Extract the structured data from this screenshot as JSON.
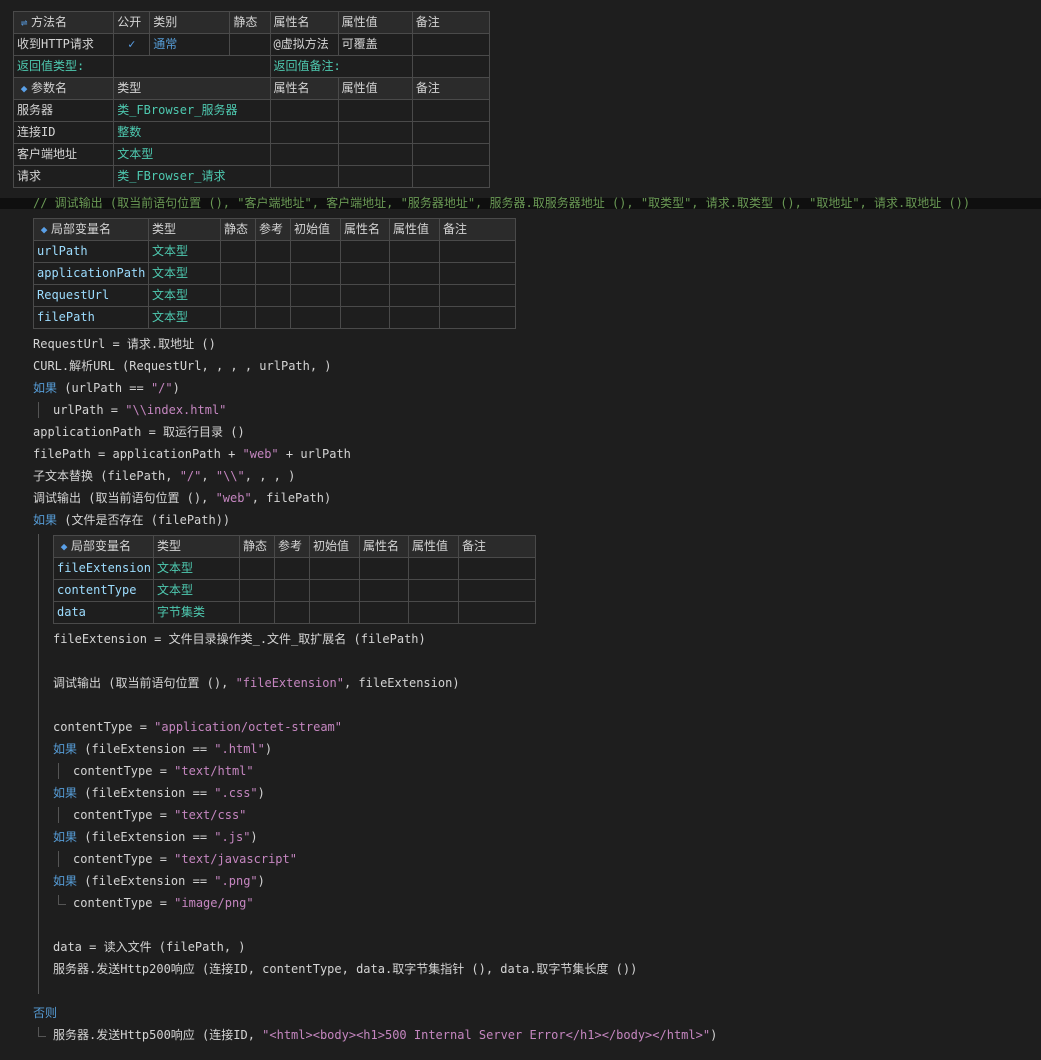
{
  "method_table": {
    "headers": [
      "方法名",
      "公开",
      "类别",
      "静态",
      "属性名",
      "属性值",
      "备注"
    ],
    "row": {
      "name": "收到HTTP请求",
      "public_check": "✓",
      "category": "通常",
      "attr_name": "@虚拟方法",
      "attr_value": "可覆盖"
    },
    "return_type_label": "返回值类型:",
    "return_note_label": "返回值备注:"
  },
  "param_table": {
    "headers": [
      "参数名",
      "类型",
      "属性名",
      "属性值",
      "备注"
    ],
    "rows": [
      {
        "name": "服务器",
        "type": "类_FBrowser_服务器"
      },
      {
        "name": "连接ID",
        "type": "整数"
      },
      {
        "name": "客户端地址",
        "type": "文本型"
      },
      {
        "name": "请求",
        "type": "类_FBrowser_请求"
      }
    ]
  },
  "comment_line": "// 调试输出 (取当前语句位置 (), \"客户端地址\", 客户端地址, \"服务器地址\", 服务器.取服务器地址 (), \"取类型\", 请求.取类型 (), \"取地址\", 请求.取地址 ())",
  "local_table_1": {
    "headers": [
      "局部变量名",
      "类型",
      "静态",
      "参考",
      "初始值",
      "属性名",
      "属性值",
      "备注"
    ],
    "rows": [
      {
        "name": "urlPath",
        "type": "文本型"
      },
      {
        "name": "applicationPath",
        "type": "文本型"
      },
      {
        "name": "RequestUrl",
        "type": "文本型"
      },
      {
        "name": "filePath",
        "type": "文本型"
      }
    ]
  },
  "code1": {
    "l1": "RequestUrl = 请求.取地址 ()",
    "l2": "CURL.解析URL (RequestUrl, , , , urlPath, )",
    "l3_kw": "如果",
    "l3_rest": " (urlPath == ",
    "l3_str": "\"/\"",
    "l3_end": ")",
    "l4_a": "urlPath = ",
    "l4_str": "\"\\\\index.html\"",
    "l5": "applicationPath = 取运行目录 ()",
    "l6_a": "filePath = applicationPath + ",
    "l6_str": "\"web\"",
    "l6_b": " + urlPath",
    "l7_a": "子文本替换 (filePath, ",
    "l7_s1": "\"/\"",
    "l7_b": ", ",
    "l7_s2": "\"\\\\\"",
    "l7_c": ", , , )",
    "l8_a": "调试输出 (取当前语句位置 (), ",
    "l8_str": "\"web\"",
    "l8_b": ", filePath)",
    "l9_kw": "如果",
    "l9_rest": " (文件是否存在 (filePath))"
  },
  "local_table_2": {
    "headers": [
      "局部变量名",
      "类型",
      "静态",
      "参考",
      "初始值",
      "属性名",
      "属性值",
      "备注"
    ],
    "rows": [
      {
        "name": "fileExtension",
        "type": "文本型"
      },
      {
        "name": "contentType",
        "type": "文本型"
      },
      {
        "name": "data",
        "type": "字节集类"
      }
    ]
  },
  "code2": {
    "fe": "fileExtension = 文件目录操作类_.文件_取扩展名 (filePath)",
    "dbg_a": "调试输出 (取当前语句位置 (), ",
    "dbg_str": "\"fileExtension\"",
    "dbg_b": ", fileExtension)",
    "ct_a": "contentType = ",
    "ct_str": "\"application/octet-stream\"",
    "if1_kw": "如果",
    "if1_a": " (fileExtension == ",
    "if1_str": "\".html\"",
    "if1_b": ")",
    "ct1_a": "contentType = ",
    "ct1_str": "\"text/html\"",
    "if2_kw": "如果",
    "if2_a": " (fileExtension == ",
    "if2_str": "\".css\"",
    "if2_b": ")",
    "ct2_a": "contentType = ",
    "ct2_str": "\"text/css\"",
    "if3_kw": "如果",
    "if3_a": " (fileExtension == ",
    "if3_str": "\".js\"",
    "if3_b": ")",
    "ct3_a": "contentType = ",
    "ct3_str": "\"text/javascript\"",
    "if4_kw": "如果",
    "if4_a": " (fileExtension == ",
    "if4_str": "\".png\"",
    "if4_b": ")",
    "ct4_a": "contentType = ",
    "ct4_str": "\"image/png\"",
    "data": "data = 读入文件 (filePath, )",
    "send200": "服务器.发送Http200响应 (连接ID, contentType, data.取字节集指针 (), data.取字节集长度 ())",
    "else_kw": "否则",
    "send500_a": "服务器.发送Http500响应 (连接ID, ",
    "send500_str": "\"<html><body><h1>500 Internal Server Error</h1></body></html>\"",
    "send500_b": ")"
  }
}
